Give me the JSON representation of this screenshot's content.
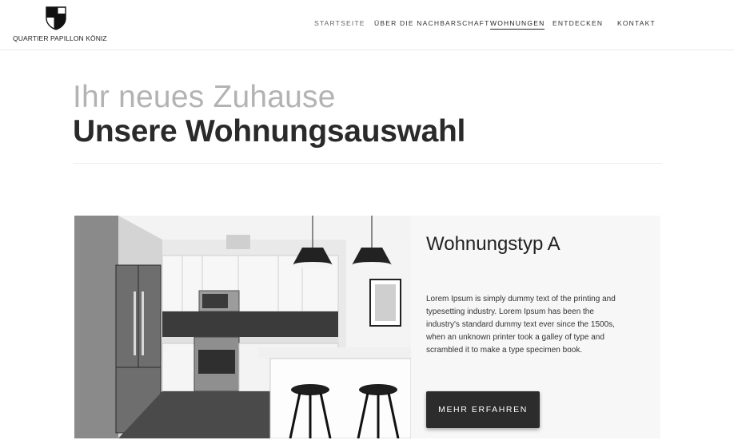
{
  "brand": {
    "name": "QUARTIER PAPILLON KÖNIZ",
    "logo_icon": "shield-cross-icon"
  },
  "nav": {
    "items": [
      {
        "label": "STARTSEITE",
        "active": false
      },
      {
        "label": "ÜBER DIE NACHBARSCHAFT",
        "active": false
      },
      {
        "label": "WOHNUNGEN",
        "active": true
      },
      {
        "label": "ENTDECKEN",
        "active": false
      },
      {
        "label": "KONTAKT",
        "active": false
      }
    ]
  },
  "hero": {
    "kicker": "Ihr neues Zuhause",
    "title": "Unsere Wohnungsauswahl"
  },
  "listing": {
    "title": "Wohnungstyp A",
    "description": "Lorem Ipsum is simply dummy text of the printing and typesetting industry. Lorem Ipsum has been the industry's standard dummy text ever since the 1500s, when an unknown printer took a galley of type and scrambled it to make a type specimen book.",
    "button_label": "MEHR ERFAHREN",
    "image_subject": "kitchen-photo"
  },
  "colors": {
    "text_dark": "#2a2a2a",
    "text_light": "#b3b3b3",
    "button_bg": "#2c2c2c",
    "card_bg": "#f7f7f7"
  }
}
